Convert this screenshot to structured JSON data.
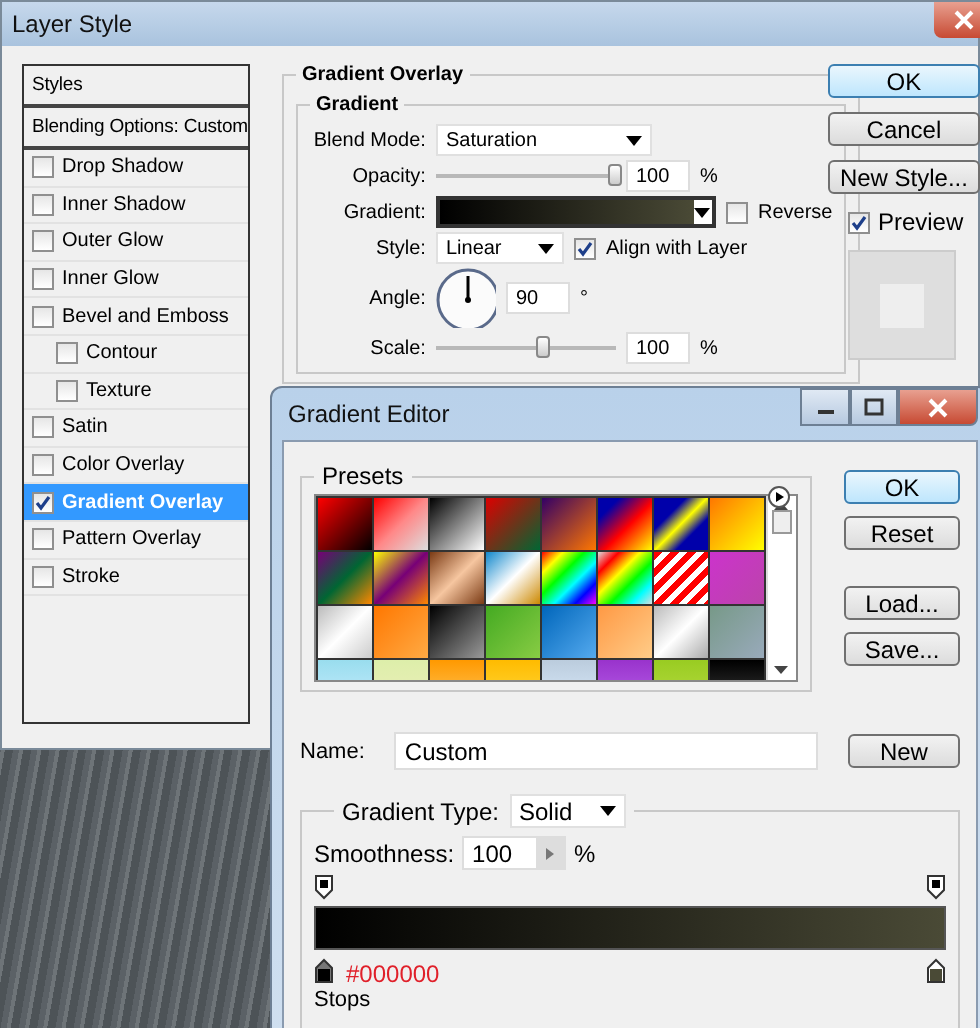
{
  "layer_style": {
    "title": "Layer Style",
    "styles_header": "Styles",
    "blending_options": "Blending Options: Custom",
    "effects": [
      {
        "label": "Drop Shadow",
        "checked": false,
        "selected": false
      },
      {
        "label": "Inner Shadow",
        "checked": false,
        "selected": false
      },
      {
        "label": "Outer Glow",
        "checked": false,
        "selected": false
      },
      {
        "label": "Inner Glow",
        "checked": false,
        "selected": false
      },
      {
        "label": "Bevel and Emboss",
        "checked": false,
        "selected": false,
        "children": [
          {
            "label": "Contour",
            "checked": false,
            "selected": false
          },
          {
            "label": "Texture",
            "checked": false,
            "selected": false
          }
        ]
      },
      {
        "label": "Satin",
        "checked": false,
        "selected": false
      },
      {
        "label": "Color Overlay",
        "checked": false,
        "selected": false
      },
      {
        "label": "Gradient Overlay",
        "checked": true,
        "selected": true
      },
      {
        "label": "Pattern Overlay",
        "checked": false,
        "selected": false
      },
      {
        "label": "Stroke",
        "checked": false,
        "selected": false
      }
    ],
    "overlay": {
      "title": "Gradient Overlay",
      "group": "Gradient",
      "blend_mode_label": "Blend Mode:",
      "blend_mode": "Saturation",
      "opacity_label": "Opacity:",
      "opacity_slider": {
        "level": 1.0
      },
      "opacity": "100",
      "opacity_unit": "%",
      "gradient_label": "Gradient:",
      "reverse": {
        "label": "Reverse",
        "checked": false
      },
      "style_label": "Style:",
      "style": "Linear",
      "align": {
        "label": "Align with Layer",
        "checked": true
      },
      "angle_label": "Angle:",
      "angle": "90",
      "angle_unit": "°",
      "scale_label": "Scale:",
      "scale_slider": {
        "level": 0.6
      },
      "scale": "100",
      "scale_unit": "%"
    },
    "buttons": [
      {
        "label": "OK",
        "default": true
      },
      {
        "label": "Cancel",
        "default": false
      },
      {
        "label": "New Style...",
        "default": false
      }
    ],
    "preview": {
      "label": "Preview",
      "checked": true
    }
  },
  "gradient_editor": {
    "title": "Gradient Editor",
    "presets_label": "Presets",
    "buttons": [
      {
        "label": "OK",
        "default": true
      },
      {
        "label": "Reset",
        "default": false
      },
      {
        "label": "Load...",
        "default": false
      },
      {
        "label": "Save...",
        "default": false
      }
    ],
    "name_label": "Name:",
    "name": "Custom",
    "new_button": "New",
    "type_label": "Gradient Type:",
    "type": "Solid",
    "smoothness_label": "Smoothness:",
    "smoothness": "100",
    "smoothness_unit": "%",
    "color_stops": [
      {
        "color": "#000000",
        "selected": true
      },
      {
        "color": "#4a4a36",
        "selected": false
      }
    ],
    "stop_color": "#000000",
    "stops_label": "Stops"
  }
}
